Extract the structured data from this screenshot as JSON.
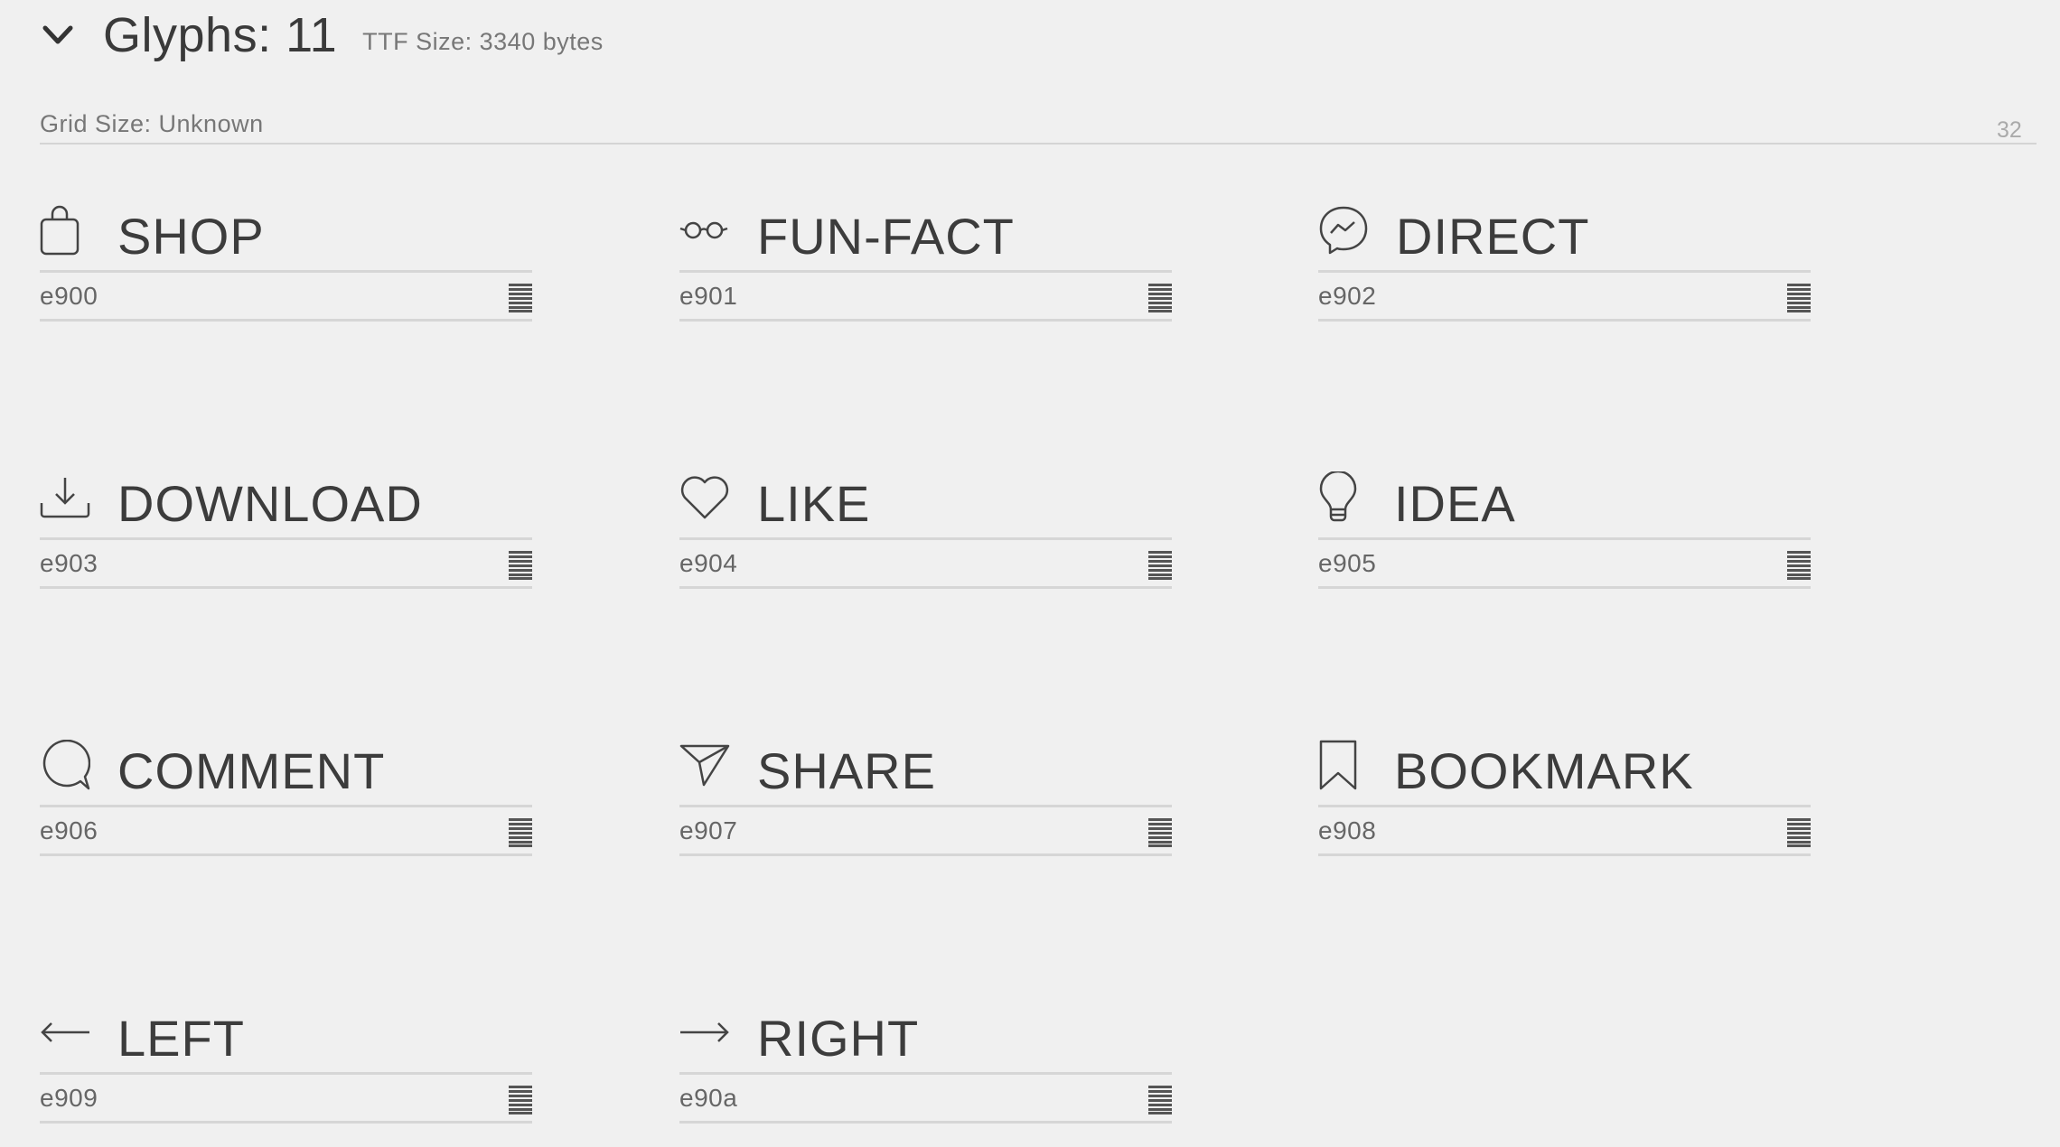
{
  "header": {
    "title": "Glyphs: 11",
    "ttf_size": "TTF Size: 3340 bytes"
  },
  "grid": {
    "label": "Grid Size: Unknown",
    "value": "32"
  },
  "glyphs": [
    {
      "name": "SHOP",
      "code": "e900",
      "icon": "shopping-bag-icon"
    },
    {
      "name": "FUN-FACT",
      "code": "e901",
      "icon": "glasses-icon"
    },
    {
      "name": "DIRECT",
      "code": "e902",
      "icon": "messenger-icon"
    },
    {
      "name": "DOWNLOAD",
      "code": "e903",
      "icon": "download-icon"
    },
    {
      "name": "LIKE",
      "code": "e904",
      "icon": "heart-icon"
    },
    {
      "name": "IDEA",
      "code": "e905",
      "icon": "lightbulb-icon"
    },
    {
      "name": "COMMENT",
      "code": "e906",
      "icon": "comment-icon"
    },
    {
      "name": "SHARE",
      "code": "e907",
      "icon": "paper-plane-icon"
    },
    {
      "name": "BOOKMARK",
      "code": "e908",
      "icon": "bookmark-icon"
    },
    {
      "name": "LEFT",
      "code": "e909",
      "icon": "arrow-left-icon"
    },
    {
      "name": "RIGHT",
      "code": "e90a",
      "icon": "arrow-right-icon"
    }
  ]
}
